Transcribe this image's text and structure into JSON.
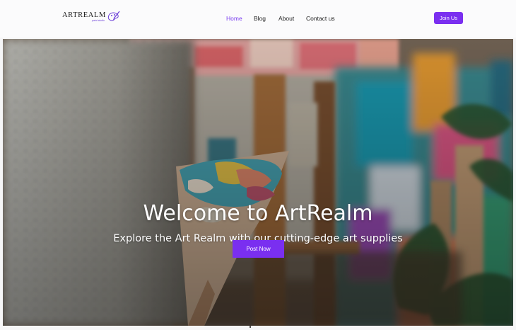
{
  "brand": {
    "name": "ARTREALM",
    "tagline": "paint studio",
    "accent": "#7a2ff0"
  },
  "nav": {
    "items": [
      {
        "label": "Home",
        "active": true
      },
      {
        "label": "Blog",
        "active": false
      },
      {
        "label": "About",
        "active": false
      },
      {
        "label": "Contact us",
        "active": false
      }
    ],
    "cta_label": "Join Us"
  },
  "hero": {
    "title": "Welcome to ArtRealm",
    "subtitle": "Explore the Art Realm with our cutting-edge art supplies",
    "button_label": "Post Now",
    "image": "artist-palette-easel-photo"
  }
}
